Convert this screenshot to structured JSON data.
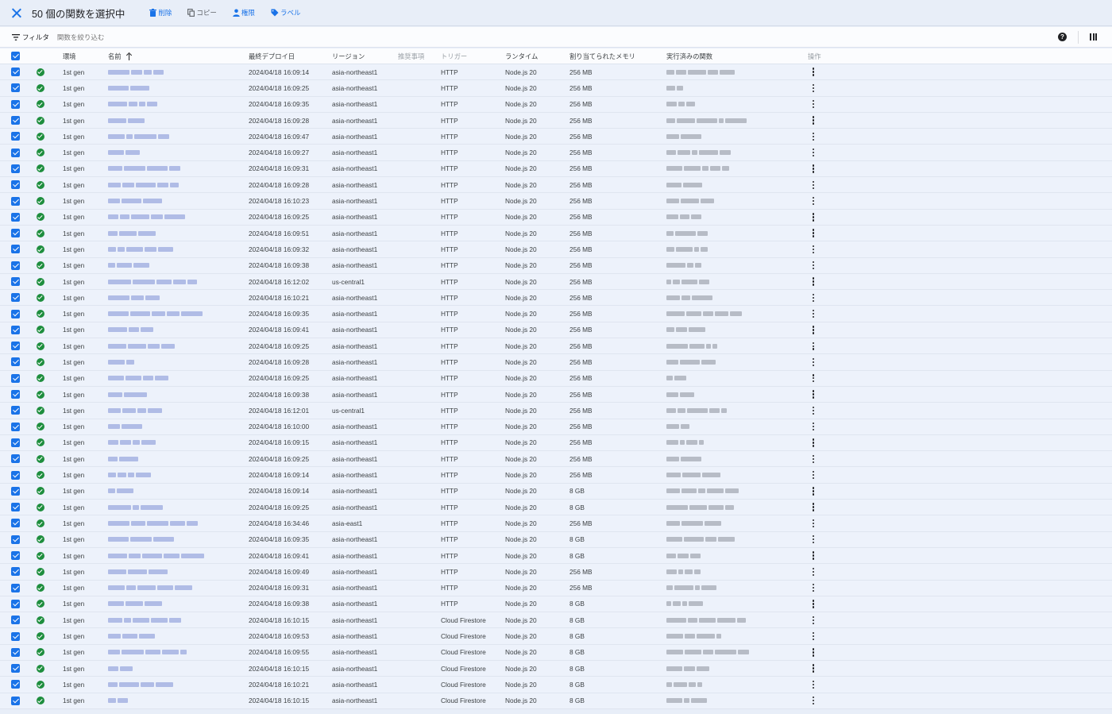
{
  "topbar": {
    "title": "50 個の関数を選択中",
    "actions": [
      {
        "label": "削除",
        "icon": "trash-icon"
      },
      {
        "label": "コピー",
        "icon": "copy-icon"
      },
      {
        "label": "権限",
        "icon": "person-icon"
      },
      {
        "label": "ラベル",
        "icon": "label-icon"
      }
    ]
  },
  "filter": {
    "label": "フィルタ",
    "placeholder": "関数を絞り込む"
  },
  "table": {
    "columns": [
      "環境",
      "名前",
      "最終デプロイ日",
      "リージョン",
      "推奨事項",
      "トリガー",
      "ランタイム",
      "割り当てられたメモリ",
      "実行済みの関数",
      "操作"
    ],
    "rows": [
      {
        "env": "1st gen",
        "deployed": "2024/04/18 16:09:14",
        "region": "asia-northeast1",
        "trigger": "HTTP",
        "runtime": "Node.js 20",
        "memory": "256 MB"
      },
      {
        "env": "1st gen",
        "deployed": "2024/04/18 16:09:25",
        "region": "asia-northeast1",
        "trigger": "HTTP",
        "runtime": "Node.js 20",
        "memory": "256 MB"
      },
      {
        "env": "1st gen",
        "deployed": "2024/04/18 16:09:35",
        "region": "asia-northeast1",
        "trigger": "HTTP",
        "runtime": "Node.js 20",
        "memory": "256 MB"
      },
      {
        "env": "1st gen",
        "deployed": "2024/04/18 16:09:28",
        "region": "asia-northeast1",
        "trigger": "HTTP",
        "runtime": "Node.js 20",
        "memory": "256 MB"
      },
      {
        "env": "1st gen",
        "deployed": "2024/04/18 16:09:47",
        "region": "asia-northeast1",
        "trigger": "HTTP",
        "runtime": "Node.js 20",
        "memory": "256 MB"
      },
      {
        "env": "1st gen",
        "deployed": "2024/04/18 16:09:27",
        "region": "asia-northeast1",
        "trigger": "HTTP",
        "runtime": "Node.js 20",
        "memory": "256 MB"
      },
      {
        "env": "1st gen",
        "deployed": "2024/04/18 16:09:31",
        "region": "asia-northeast1",
        "trigger": "HTTP",
        "runtime": "Node.js 20",
        "memory": "256 MB"
      },
      {
        "env": "1st gen",
        "deployed": "2024/04/18 16:09:28",
        "region": "asia-northeast1",
        "trigger": "HTTP",
        "runtime": "Node.js 20",
        "memory": "256 MB"
      },
      {
        "env": "1st gen",
        "deployed": "2024/04/18 16:10:23",
        "region": "asia-northeast1",
        "trigger": "HTTP",
        "runtime": "Node.js 20",
        "memory": "256 MB"
      },
      {
        "env": "1st gen",
        "deployed": "2024/04/18 16:09:25",
        "region": "asia-northeast1",
        "trigger": "HTTP",
        "runtime": "Node.js 20",
        "memory": "256 MB"
      },
      {
        "env": "1st gen",
        "deployed": "2024/04/18 16:09:51",
        "region": "asia-northeast1",
        "trigger": "HTTP",
        "runtime": "Node.js 20",
        "memory": "256 MB"
      },
      {
        "env": "1st gen",
        "deployed": "2024/04/18 16:09:32",
        "region": "asia-northeast1",
        "trigger": "HTTP",
        "runtime": "Node.js 20",
        "memory": "256 MB"
      },
      {
        "env": "1st gen",
        "deployed": "2024/04/18 16:09:38",
        "region": "asia-northeast1",
        "trigger": "HTTP",
        "runtime": "Node.js 20",
        "memory": "256 MB"
      },
      {
        "env": "1st gen",
        "deployed": "2024/04/18 16:12:02",
        "region": "us-central1",
        "trigger": "HTTP",
        "runtime": "Node.js 20",
        "memory": "256 MB"
      },
      {
        "env": "1st gen",
        "deployed": "2024/04/18 16:10:21",
        "region": "asia-northeast1",
        "trigger": "HTTP",
        "runtime": "Node.js 20",
        "memory": "256 MB"
      },
      {
        "env": "1st gen",
        "deployed": "2024/04/18 16:09:35",
        "region": "asia-northeast1",
        "trigger": "HTTP",
        "runtime": "Node.js 20",
        "memory": "256 MB"
      },
      {
        "env": "1st gen",
        "deployed": "2024/04/18 16:09:41",
        "region": "asia-northeast1",
        "trigger": "HTTP",
        "runtime": "Node.js 20",
        "memory": "256 MB"
      },
      {
        "env": "1st gen",
        "deployed": "2024/04/18 16:09:25",
        "region": "asia-northeast1",
        "trigger": "HTTP",
        "runtime": "Node.js 20",
        "memory": "256 MB"
      },
      {
        "env": "1st gen",
        "deployed": "2024/04/18 16:09:28",
        "region": "asia-northeast1",
        "trigger": "HTTP",
        "runtime": "Node.js 20",
        "memory": "256 MB"
      },
      {
        "env": "1st gen",
        "deployed": "2024/04/18 16:09:25",
        "region": "asia-northeast1",
        "trigger": "HTTP",
        "runtime": "Node.js 20",
        "memory": "256 MB"
      },
      {
        "env": "1st gen",
        "deployed": "2024/04/18 16:09:38",
        "region": "asia-northeast1",
        "trigger": "HTTP",
        "runtime": "Node.js 20",
        "memory": "256 MB"
      },
      {
        "env": "1st gen",
        "deployed": "2024/04/18 16:12:01",
        "region": "us-central1",
        "trigger": "HTTP",
        "runtime": "Node.js 20",
        "memory": "256 MB"
      },
      {
        "env": "1st gen",
        "deployed": "2024/04/18 16:10:00",
        "region": "asia-northeast1",
        "trigger": "HTTP",
        "runtime": "Node.js 20",
        "memory": "256 MB"
      },
      {
        "env": "1st gen",
        "deployed": "2024/04/18 16:09:15",
        "region": "asia-northeast1",
        "trigger": "HTTP",
        "runtime": "Node.js 20",
        "memory": "256 MB"
      },
      {
        "env": "1st gen",
        "deployed": "2024/04/18 16:09:25",
        "region": "asia-northeast1",
        "trigger": "HTTP",
        "runtime": "Node.js 20",
        "memory": "256 MB"
      },
      {
        "env": "1st gen",
        "deployed": "2024/04/18 16:09:14",
        "region": "asia-northeast1",
        "trigger": "HTTP",
        "runtime": "Node.js 20",
        "memory": "256 MB"
      },
      {
        "env": "1st gen",
        "deployed": "2024/04/18 16:09:14",
        "region": "asia-northeast1",
        "trigger": "HTTP",
        "runtime": "Node.js 20",
        "memory": "8 GB"
      },
      {
        "env": "1st gen",
        "deployed": "2024/04/18 16:09:25",
        "region": "asia-northeast1",
        "trigger": "HTTP",
        "runtime": "Node.js 20",
        "memory": "8 GB"
      },
      {
        "env": "1st gen",
        "deployed": "2024/04/18 16:34:46",
        "region": "asia-east1",
        "trigger": "HTTP",
        "runtime": "Node.js 20",
        "memory": "256 MB"
      },
      {
        "env": "1st gen",
        "deployed": "2024/04/18 16:09:35",
        "region": "asia-northeast1",
        "trigger": "HTTP",
        "runtime": "Node.js 20",
        "memory": "8 GB"
      },
      {
        "env": "1st gen",
        "deployed": "2024/04/18 16:09:41",
        "region": "asia-northeast1",
        "trigger": "HTTP",
        "runtime": "Node.js 20",
        "memory": "8 GB"
      },
      {
        "env": "1st gen",
        "deployed": "2024/04/18 16:09:49",
        "region": "asia-northeast1",
        "trigger": "HTTP",
        "runtime": "Node.js 20",
        "memory": "256 MB"
      },
      {
        "env": "1st gen",
        "deployed": "2024/04/18 16:09:31",
        "region": "asia-northeast1",
        "trigger": "HTTP",
        "runtime": "Node.js 20",
        "memory": "256 MB"
      },
      {
        "env": "1st gen",
        "deployed": "2024/04/18 16:09:38",
        "region": "asia-northeast1",
        "trigger": "HTTP",
        "runtime": "Node.js 20",
        "memory": "8 GB"
      },
      {
        "env": "1st gen",
        "deployed": "2024/04/18 16:10:15",
        "region": "asia-northeast1",
        "trigger": "Cloud Firestore",
        "runtime": "Node.js 20",
        "memory": "8 GB"
      },
      {
        "env": "1st gen",
        "deployed": "2024/04/18 16:09:53",
        "region": "asia-northeast1",
        "trigger": "Cloud Firestore",
        "runtime": "Node.js 20",
        "memory": "8 GB"
      },
      {
        "env": "1st gen",
        "deployed": "2024/04/18 16:09:55",
        "region": "asia-northeast1",
        "trigger": "Cloud Firestore",
        "runtime": "Node.js 20",
        "memory": "8 GB"
      },
      {
        "env": "1st gen",
        "deployed": "2024/04/18 16:10:15",
        "region": "asia-northeast1",
        "trigger": "Cloud Firestore",
        "runtime": "Node.js 20",
        "memory": "8 GB"
      },
      {
        "env": "1st gen",
        "deployed": "2024/04/18 16:10:21",
        "region": "asia-northeast1",
        "trigger": "Cloud Firestore",
        "runtime": "Node.js 20",
        "memory": "8 GB"
      },
      {
        "env": "1st gen",
        "deployed": "2024/04/18 16:10:15",
        "region": "asia-northeast1",
        "trigger": "Cloud Firestore",
        "runtime": "Node.js 20",
        "memory": "8 GB"
      }
    ]
  },
  "colors": {
    "accent": "#1a73e8",
    "status_ok": "#1e8e3e",
    "selected_row": "#edf2fb"
  }
}
